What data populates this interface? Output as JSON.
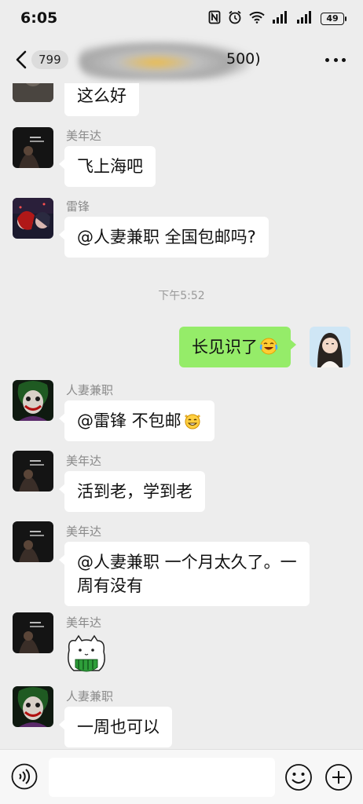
{
  "status": {
    "time": "6:05",
    "battery": "49"
  },
  "nav": {
    "unread": "799",
    "title_suffix": "500)"
  },
  "messages": {
    "m0": {
      "text": "这么好"
    },
    "m1": {
      "sender": "美年达",
      "text": "飞上海吧"
    },
    "m2": {
      "sender": "雷锋",
      "text": "@人妻兼职  全国包邮吗?"
    },
    "timestamp": "下午5:52",
    "m3": {
      "text": "长见识了"
    },
    "m4": {
      "sender": "人妻兼职",
      "text": "@雷锋  不包邮"
    },
    "m5": {
      "sender": "美年达",
      "text": "活到老，学到老"
    },
    "m6": {
      "sender": "美年达",
      "line1": "@人妻兼职  一个月太久了。一",
      "line2": "周有没有"
    },
    "m7": {
      "sender": "美年达",
      "sticker": "cat-watermelon-sticker"
    },
    "m8": {
      "sender": "人妻兼职",
      "text": "一周也可以"
    }
  },
  "colors": {
    "background": "#ededed",
    "my_bubble": "#95ec69",
    "other_bubble": "#ffffff"
  },
  "icons": [
    "back-icon",
    "more-icon",
    "voice-icon",
    "emoji-icon",
    "plus-icon",
    "laugh-cry-emoji",
    "cat-grin-emoji"
  ]
}
